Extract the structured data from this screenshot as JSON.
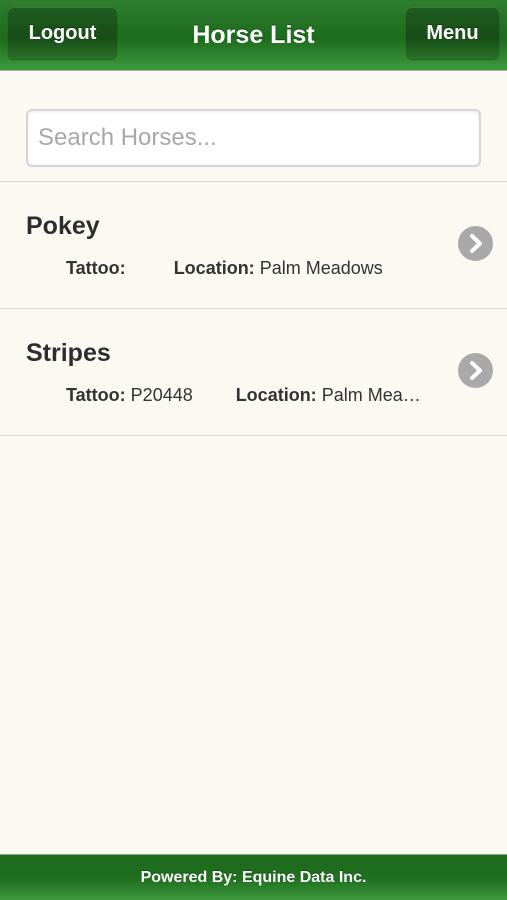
{
  "header": {
    "title": "Horse List",
    "logout_label": "Logout",
    "menu_label": "Menu"
  },
  "search": {
    "placeholder": "Search Horses...",
    "value": ""
  },
  "horses": [
    {
      "name": "Pokey",
      "tattoo_label": "Tattoo:",
      "tattoo": "",
      "location_label": "Location:",
      "location": "Palm Meadows"
    },
    {
      "name": "Stripes",
      "tattoo_label": "Tattoo:",
      "tattoo": "P20448",
      "location_label": "Location:",
      "location": "Palm Mea…"
    }
  ],
  "footer": {
    "text": "Powered By: Equine Data Inc."
  },
  "colors": {
    "header_green": "#1d6b1d",
    "background": "#fbfaf2",
    "chevron_gray": "#a9a9a9"
  },
  "icons": {
    "row_disclosure": "chevron-right-icon"
  }
}
